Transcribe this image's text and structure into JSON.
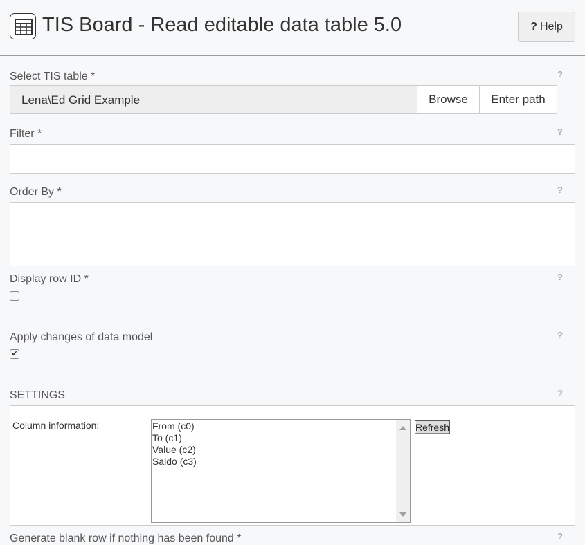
{
  "header": {
    "title": "TIS Board - Read editable data table 5.0",
    "help_label": "Help",
    "help_mark": "?"
  },
  "help_mark": "?",
  "fields": {
    "tis_table": {
      "label": "Select TIS table *",
      "value": "Lena\\Ed Grid Example",
      "browse_label": "Browse",
      "enter_path_label": "Enter path"
    },
    "filter": {
      "label": "Filter *",
      "value": ""
    },
    "order_by": {
      "label": "Order By *",
      "value": ""
    },
    "display_row_id": {
      "label": "Display row ID *",
      "checked": false
    },
    "apply_changes": {
      "label": "Apply changes of data model",
      "checked": true,
      "mark": "✔"
    },
    "settings": {
      "label": "SETTINGS",
      "column_info_label": "Column information:",
      "columns": [
        "From (c0)",
        "To (c1)",
        "Value (c2)",
        "Saldo (c3)"
      ],
      "refresh_label": "Refresh"
    },
    "generate_blank_row": {
      "label": "Generate blank row if nothing has been found *"
    }
  }
}
